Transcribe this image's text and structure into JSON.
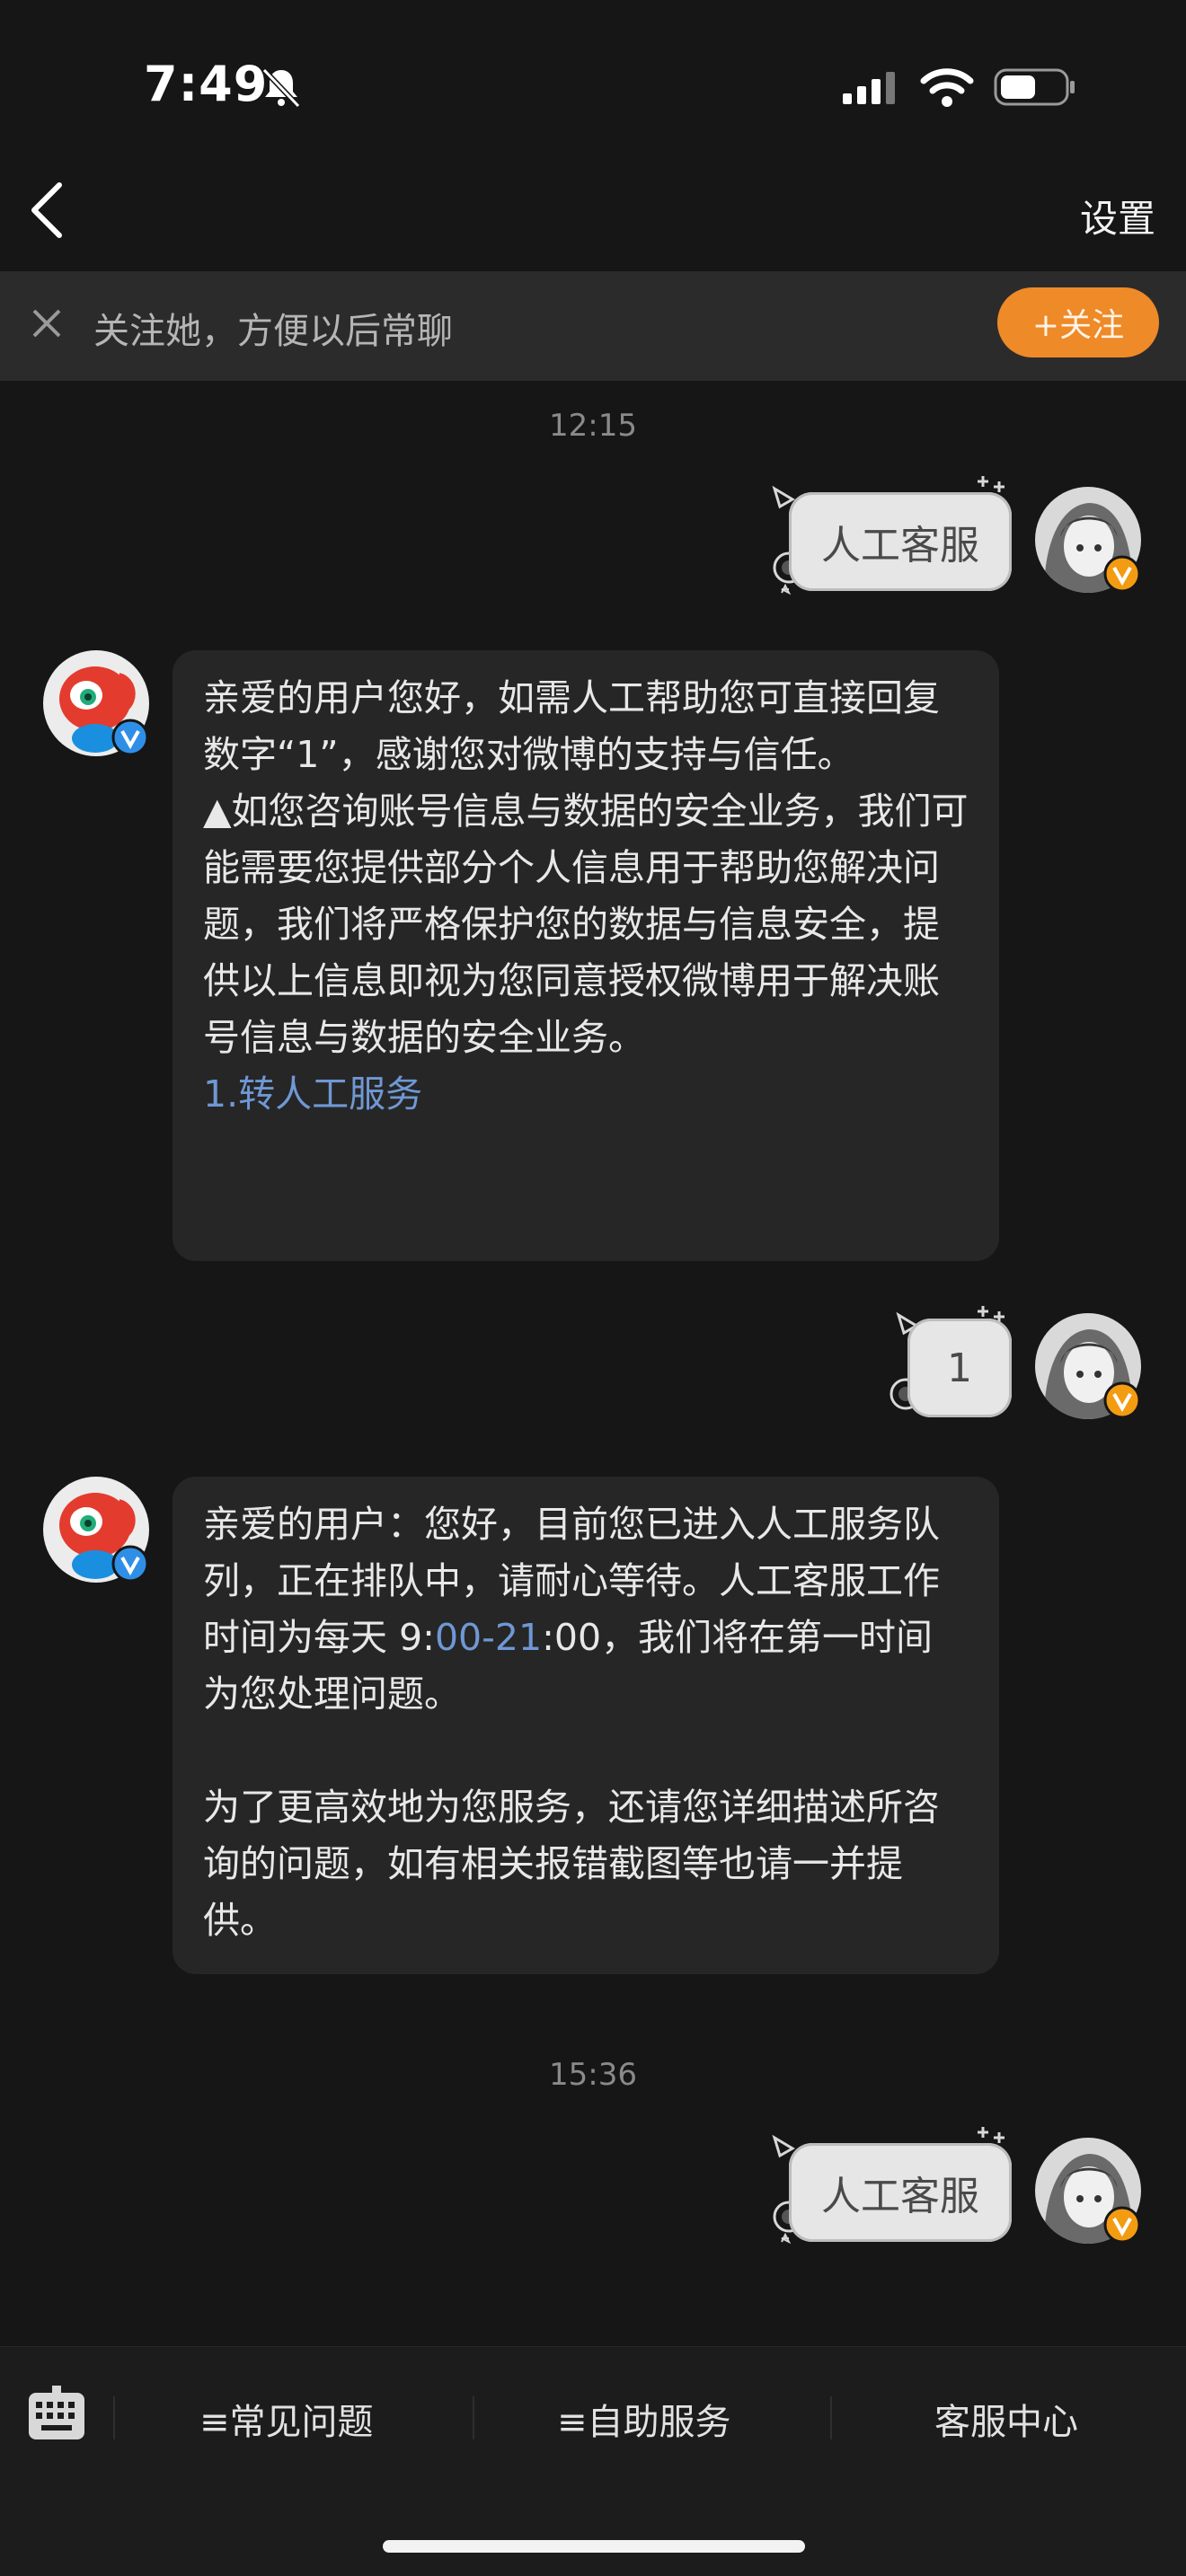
{
  "status_bar": {
    "time": "7:49"
  },
  "nav": {
    "title": "",
    "settings_label": "设置"
  },
  "banner": {
    "text": "关注她，方便以后常聊",
    "follow_label": "+关注"
  },
  "conversation": {
    "ts1": "12:15",
    "user_msg_1": "人工客服",
    "agent_msg_1": {
      "line1": "亲爱的用户您好，如需人工帮助您可直接回复数字“1”，感谢您对微博的支持与信任。",
      "line2": "▲如您咨询账号信息与数据的安全业务，我们可能需要您提供部分个人信息用于帮助您解决问题，我们将严格保护您的数据与信息安全，提供以上信息即视为您同意授权微博用于解决账号信息与数据的安全业务。",
      "link": "1.转人工服务"
    },
    "user_msg_2": "1",
    "agent_msg_2": {
      "para1_pre": "亲爱的用户：您好，目前您已进入人工服务队列，正在排队中，请耐心等待。人工客服工作时间为每天 9:",
      "para1_link": "00-21",
      "para1_post": ":00，我们将在第一时间为您处理问题。",
      "para2": "为了更高效地为您服务，还请您详细描述所咨询的问题，如有相关报错截图等也请一并提供。"
    },
    "ts2": "15:36",
    "user_msg_3": "人工客服"
  },
  "bottom_bar": {
    "menu1": "≡常见问题",
    "menu2": "≡自助服务",
    "menu3": "客服中心"
  },
  "colors": {
    "accent": "#ee8a27",
    "link": "#6f98d4",
    "background": "#161616",
    "bubble": "#262626"
  },
  "icons": [
    "bell-slash-icon",
    "signal-icon",
    "wifi-icon",
    "battery-icon",
    "back-icon",
    "close-icon",
    "keyboard-icon",
    "verified-badge-icon"
  ]
}
